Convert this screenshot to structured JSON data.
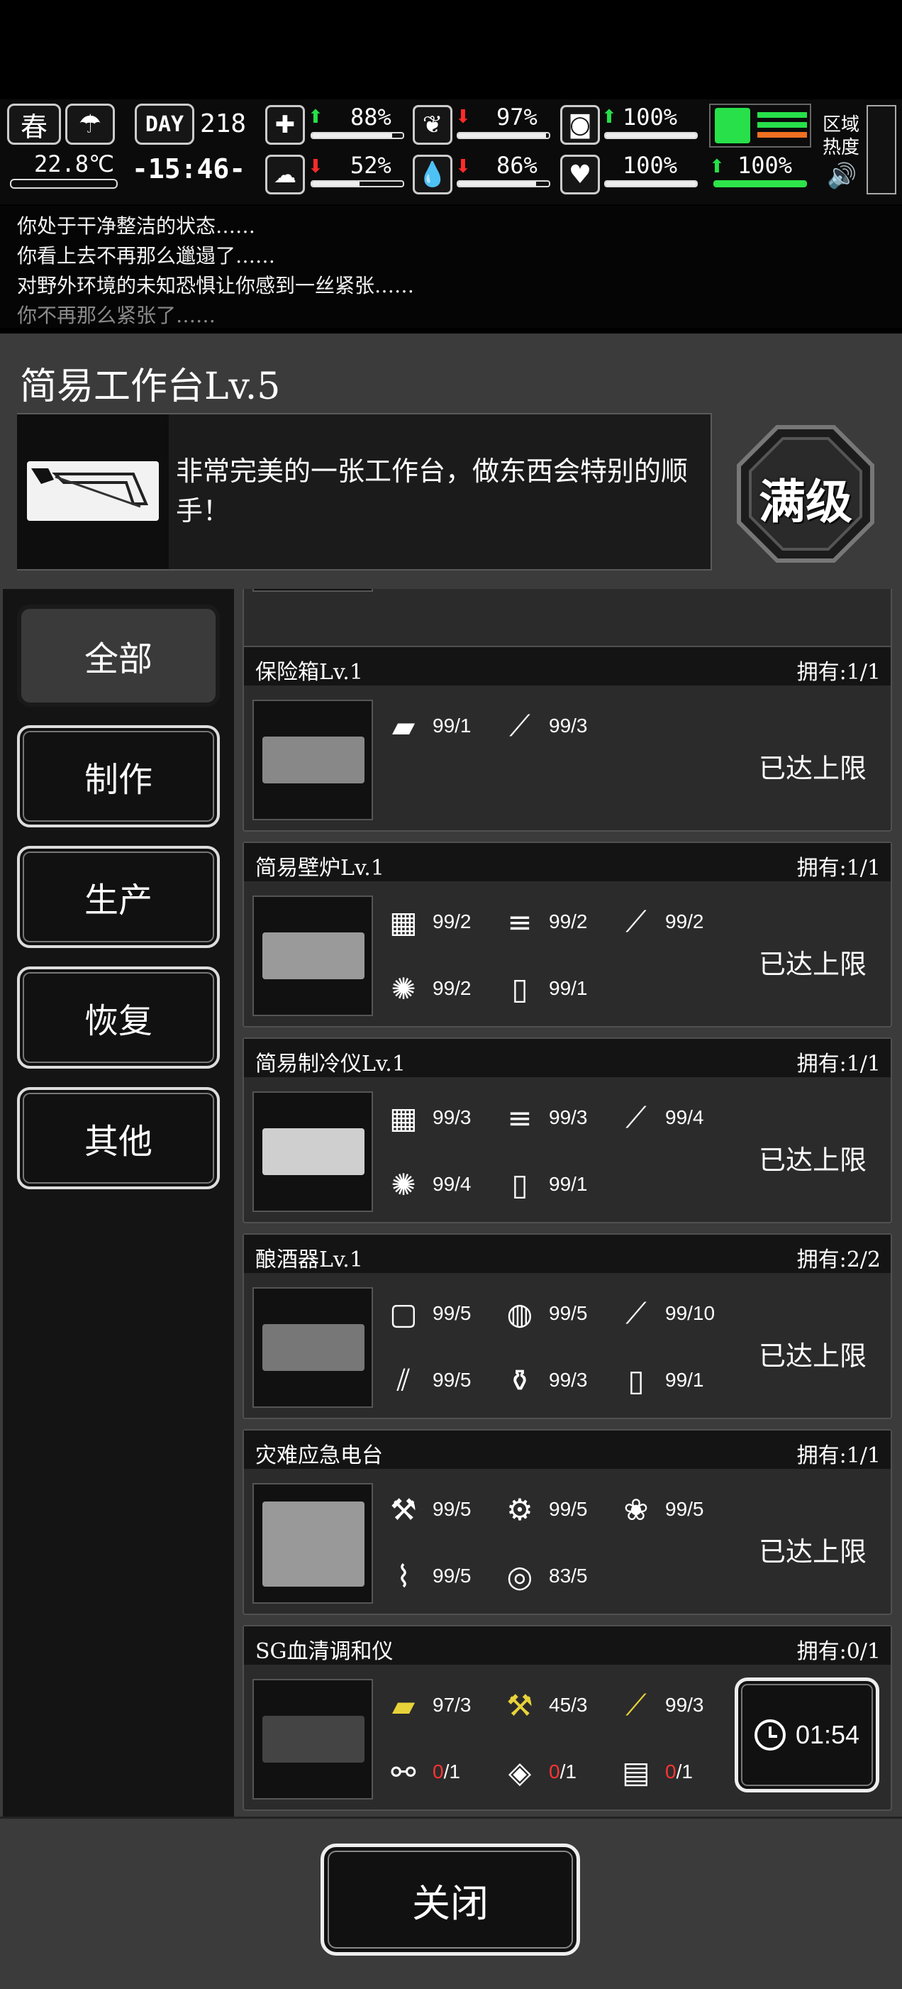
{
  "hud": {
    "season": "春",
    "day_label": "DAY",
    "day": "218",
    "temperature": "22.8℃",
    "time": "-15:46-",
    "region_heat": "区域\n热度",
    "stats": [
      {
        "icon": "medkit-icon",
        "trend": "up",
        "value": "88%",
        "level": 0.88
      },
      {
        "icon": "stomach-icon",
        "trend": "down",
        "value": "97%",
        "level": 0.97
      },
      {
        "icon": "hygiene-icon",
        "trend": "up",
        "value": "100%",
        "level": 1.0
      },
      {
        "icon": "brain-icon",
        "trend": "down",
        "value": "52%",
        "level": 0.52
      },
      {
        "icon": "water-drop-icon",
        "trend": "down",
        "value": "86%",
        "level": 0.86
      },
      {
        "icon": "heart-icon",
        "trend": "none",
        "value": "100%",
        "level": 1.0
      },
      {
        "icon": "stamina-icon",
        "trend": "up",
        "value": "100%",
        "level": 1.0
      }
    ]
  },
  "messages": [
    {
      "text": "你处于干净整洁的状态……",
      "faded": false
    },
    {
      "text": "你看上去不再那么邋遢了……",
      "faded": false
    },
    {
      "text": "对野外环境的未知恐惧让你感到一丝紧张……",
      "faded": false
    },
    {
      "text": "你不再那么紧张了……",
      "faded": true
    }
  ],
  "workbench": {
    "title": "简易工作台Lv.5",
    "description": "非常完美的一张工作台，做东西会特别的顺手！",
    "max_badge": "满级"
  },
  "categories": [
    {
      "label": "全部",
      "active": true
    },
    {
      "label": "制作",
      "active": false
    },
    {
      "label": "生产",
      "active": false
    },
    {
      "label": "恢复",
      "active": false
    },
    {
      "label": "其他",
      "active": false
    }
  ],
  "recipes": [
    {
      "name": "保险箱Lv.1",
      "owned": "拥有:1/1",
      "status": "已达上限",
      "reqs": [
        {
          "icon": "plank-icon",
          "count": "99/1"
        },
        {
          "icon": "nails-icon",
          "count": "99/3"
        }
      ]
    },
    {
      "name": "简易壁炉Lv.1",
      "owned": "拥有:1/1",
      "status": "已达上限",
      "reqs": [
        {
          "icon": "bricks-icon",
          "count": "99/2"
        },
        {
          "icon": "logs-icon",
          "count": "99/2"
        },
        {
          "icon": "nails-icon",
          "count": "99/2"
        },
        {
          "icon": "fiber-icon",
          "count": "99/2"
        },
        {
          "icon": "fuel-can-icon",
          "count": "99/1"
        }
      ]
    },
    {
      "name": "简易制冷仪Lv.1",
      "owned": "拥有:1/1",
      "status": "已达上限",
      "reqs": [
        {
          "icon": "bricks-icon",
          "count": "99/3"
        },
        {
          "icon": "logs-icon",
          "count": "99/3"
        },
        {
          "icon": "nails-icon",
          "count": "99/4"
        },
        {
          "icon": "fiber-icon",
          "count": "99/4"
        },
        {
          "icon": "fuel-can-icon",
          "count": "99/1"
        }
      ]
    },
    {
      "name": "酿酒器Lv.1",
      "owned": "拥有:2/2",
      "status": "已达上限",
      "reqs": [
        {
          "icon": "cloth-icon",
          "count": "99/5"
        },
        {
          "icon": "mesh-icon",
          "count": "99/5"
        },
        {
          "icon": "nails-icon",
          "count": "99/10"
        },
        {
          "icon": "sticks-icon",
          "count": "99/5"
        },
        {
          "icon": "bottle-icon",
          "count": "99/3"
        },
        {
          "icon": "fuel-can-icon",
          "count": "99/1"
        }
      ]
    },
    {
      "name": "灾难应急电台",
      "owned": "拥有:1/1",
      "status": "已达上限",
      "reqs": [
        {
          "icon": "parts-icon",
          "count": "99/5"
        },
        {
          "icon": "gears-icon",
          "count": "99/5"
        },
        {
          "icon": "scrap-icon",
          "count": "99/5"
        },
        {
          "icon": "wires-icon",
          "count": "99/5"
        },
        {
          "icon": "coil-icon",
          "count": "83/5"
        }
      ]
    },
    {
      "name": "SG血清调和仪",
      "owned": "拥有:0/1",
      "status": "",
      "timer": "01:54",
      "reqs": [
        {
          "icon": "yellow-card-icon",
          "count": "97/3"
        },
        {
          "icon": "yellow-parts-icon",
          "count": "45/3"
        },
        {
          "icon": "syringe-icon",
          "count": "99/3"
        },
        {
          "icon": "blueprint-tools-icon",
          "have": "0",
          "need": "/1"
        },
        {
          "icon": "blueprint-device-icon",
          "have": "0",
          "need": "/1"
        },
        {
          "icon": "blueprint-board-icon",
          "have": "0",
          "need": "/1"
        }
      ]
    }
  ],
  "close_label": "关闭"
}
